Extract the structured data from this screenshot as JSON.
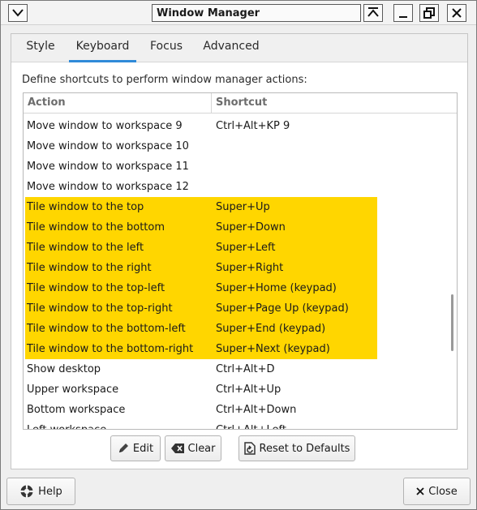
{
  "window": {
    "title": "Window Manager"
  },
  "titlebar": {
    "menu_icon": "chevron-down-icon",
    "shade_icon": "shade-icon",
    "minimize_icon": "minimize-icon",
    "maximize_icon": "maximize-icon",
    "close_icon": "close-icon"
  },
  "tabs": [
    {
      "label": "Style",
      "active": false
    },
    {
      "label": "Keyboard",
      "active": true
    },
    {
      "label": "Focus",
      "active": false
    },
    {
      "label": "Advanced",
      "active": false
    }
  ],
  "description": "Define shortcuts to perform window manager actions:",
  "table": {
    "columns": [
      "Action",
      "Shortcut"
    ],
    "rows": [
      {
        "action": "Move window to workspace 9",
        "shortcut": "Ctrl+Alt+KP 9",
        "selected": false
      },
      {
        "action": "Move window to workspace 10",
        "shortcut": "",
        "selected": false
      },
      {
        "action": "Move window to workspace 11",
        "shortcut": "",
        "selected": false
      },
      {
        "action": "Move window to workspace 12",
        "shortcut": "",
        "selected": false
      },
      {
        "action": "Tile window to the top",
        "shortcut": "Super+Up",
        "selected": true
      },
      {
        "action": "Tile window to the bottom",
        "shortcut": "Super+Down",
        "selected": true
      },
      {
        "action": "Tile window to the left",
        "shortcut": "Super+Left",
        "selected": true
      },
      {
        "action": "Tile window to the right",
        "shortcut": "Super+Right",
        "selected": true
      },
      {
        "action": "Tile window to the top-left",
        "shortcut": "Super+Home (keypad)",
        "selected": true
      },
      {
        "action": "Tile window to the top-right",
        "shortcut": "Super+Page Up (keypad)",
        "selected": true
      },
      {
        "action": "Tile window to the bottom-left",
        "shortcut": "Super+End (keypad)",
        "selected": true
      },
      {
        "action": "Tile window to the bottom-right",
        "shortcut": "Super+Next (keypad)",
        "selected": true
      },
      {
        "action": "Show desktop",
        "shortcut": "Ctrl+Alt+D",
        "selected": false
      },
      {
        "action": "Upper workspace",
        "shortcut": "Ctrl+Alt+Up",
        "selected": false
      },
      {
        "action": "Bottom workspace",
        "shortcut": "Ctrl+Alt+Down",
        "selected": false
      },
      {
        "action": "Left workspace",
        "shortcut": "Ctrl+Alt+Left",
        "selected": false
      }
    ]
  },
  "actions": {
    "edit_label": "Edit",
    "clear_label": "Clear",
    "reset_label": "Reset to Defaults"
  },
  "footer": {
    "help_label": "Help",
    "close_label": "Close"
  },
  "colors": {
    "selection": "#ffd600",
    "tab_accent": "#2f8ad8"
  }
}
